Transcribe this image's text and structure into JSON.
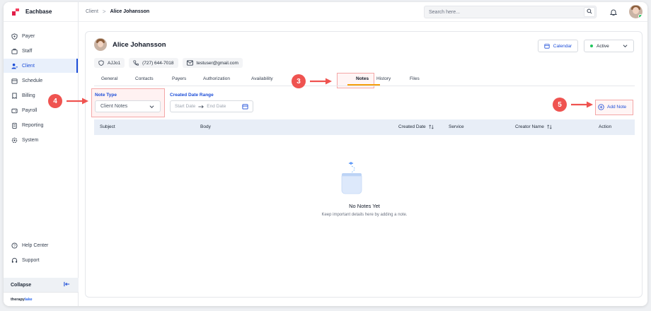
{
  "app": {
    "name": "Eachbase",
    "footer_brand_a": "therapy",
    "footer_brand_b": "lake"
  },
  "sidebar": {
    "items": [
      {
        "label": "Payer",
        "icon": "shield-dollar-icon"
      },
      {
        "label": "Staff",
        "icon": "briefcase-icon"
      },
      {
        "label": "Client",
        "icon": "users-icon",
        "active": true
      },
      {
        "label": "Schedule",
        "icon": "calendar-icon"
      },
      {
        "label": "Billing",
        "icon": "receipt-icon"
      },
      {
        "label": "Payroll",
        "icon": "wallet-icon"
      },
      {
        "label": "Reporting",
        "icon": "clipboard-icon"
      },
      {
        "label": "System",
        "icon": "cog-icon"
      }
    ],
    "help_center": "Help Center",
    "support": "Support",
    "collapse": "Collapse"
  },
  "topbar": {
    "breadcrumb_root": "Client",
    "breadcrumb_sep": ">",
    "breadcrumb_current": "Alice Johansson",
    "search_placeholder": "Search here..."
  },
  "client": {
    "name": "Alice Johansson",
    "id": "AJJo1",
    "phone": "(727) 644-7018",
    "email": "testuser@gmail.com",
    "calendar_label": "Calendar",
    "status": "Active"
  },
  "tabs": [
    "General",
    "Contacts",
    "Payers",
    "Authorization",
    "Availability",
    "Notes",
    "History",
    "Files"
  ],
  "active_tab": "Notes",
  "filters": {
    "note_type_label": "Note Type",
    "note_type_value": "Client Notes",
    "date_range_label": "Created Date Range",
    "start_placeholder": "Start Date",
    "end_placeholder": "End Date"
  },
  "add_note_label": "Add Note",
  "table": {
    "columns": [
      "Subject",
      "Body",
      "Created Date",
      "Service",
      "Creator Name",
      "Action"
    ]
  },
  "empty": {
    "title": "No Notes Yet",
    "subtitle": "Keep important details here by adding a note."
  },
  "steps": [
    "3",
    "4",
    "5"
  ],
  "colors": {
    "accent": "#1d4ed8",
    "marker": "#ef5350",
    "tab_underline": "#f59e0b",
    "status": "#22c55e"
  }
}
